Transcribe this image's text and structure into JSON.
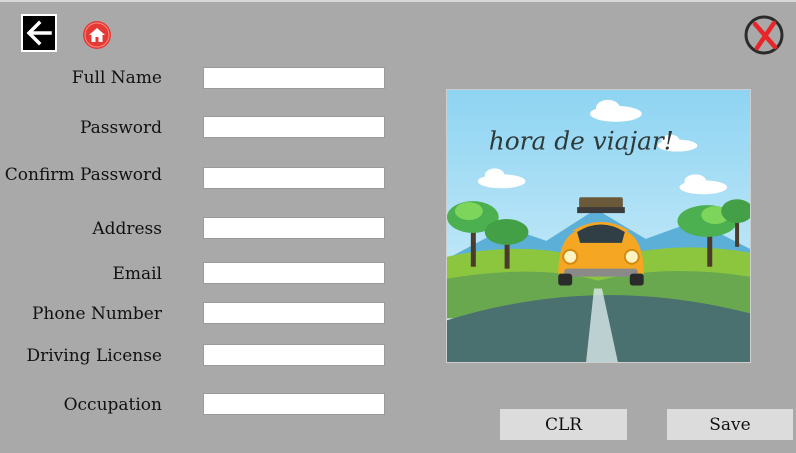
{
  "toolbar": {
    "back_icon": "arrow-left-icon",
    "home_icon": "home-icon",
    "close_icon": "close-icon"
  },
  "form": {
    "full_name_label": "Full Name",
    "password_label": "Password",
    "confirm_password_label": "Confirm Password",
    "address_label": "Address",
    "email_label": "Email",
    "phone_label": "Phone Number",
    "license_label": "Driving License",
    "occupation_label": "Occupation",
    "full_name_value": "",
    "password_value": "",
    "confirm_password_value": "",
    "address_value": "",
    "email_value": "",
    "phone_value": "",
    "license_value": "",
    "occupation_value": ""
  },
  "illustration": {
    "caption": "hora de viajar!"
  },
  "actions": {
    "clear_label": "CLR",
    "save_label": "Save"
  },
  "colors": {
    "background": "#a9a9a9",
    "close_red": "#e8262a",
    "home_red": "#e53935",
    "car_yellow": "#f5a623"
  }
}
